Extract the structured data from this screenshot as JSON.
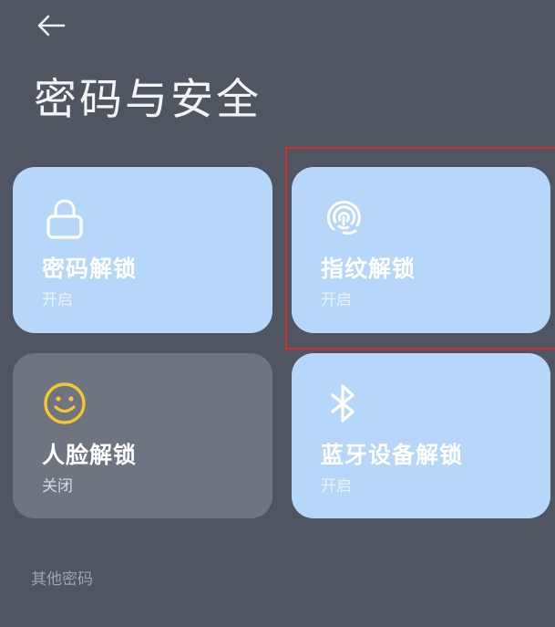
{
  "header": {
    "back_icon": "arrow-left-icon",
    "title": "密码与安全"
  },
  "cards": [
    {
      "icon": "lock-icon",
      "label": "密码解锁",
      "status": "开启",
      "enabled": true
    },
    {
      "icon": "fingerprint-icon",
      "label": "指纹解锁",
      "status": "开启",
      "enabled": true
    },
    {
      "icon": "smiley-face-icon",
      "label": "人脸解锁",
      "status": "关闭",
      "enabled": false
    },
    {
      "icon": "bluetooth-icon",
      "label": "蓝牙设备解锁",
      "status": "开启",
      "enabled": true
    }
  ],
  "sections": {
    "other_passwords": "其他密码"
  },
  "colors": {
    "background": "#4f5662",
    "card_on": "#b6d7fa",
    "card_off": "#6e7480",
    "face_icon": "#f5c431",
    "highlight": "#d92b2b"
  }
}
